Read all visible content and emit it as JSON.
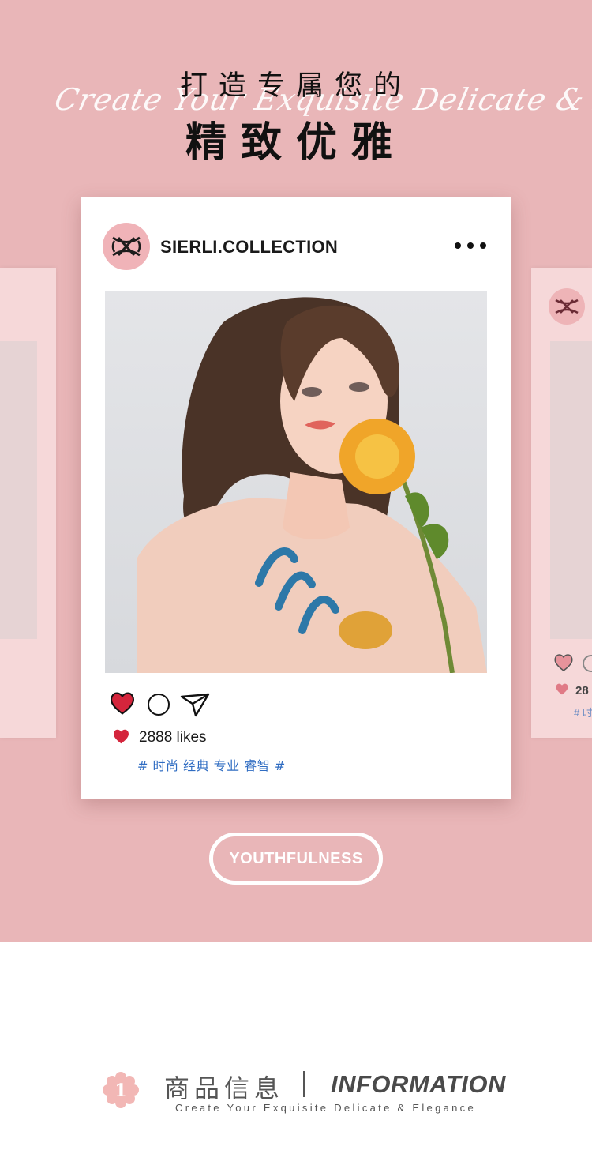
{
  "hero": {
    "title_line1": "打造专属您的",
    "script_text": "Create Your Exquisite Delicate & Elegance",
    "title_line2": "精致优雅",
    "background_color": "#e9b6b8"
  },
  "post": {
    "username": "SIERLI.COLLECTION",
    "more_icon": "more-icon",
    "likes_text": "2888 likes",
    "tags": "# 时尚 经典 专业 睿智 #",
    "icons": [
      "heart-icon",
      "comment-icon",
      "share-icon"
    ],
    "heart_color": "#d4253c",
    "tag_color": "#2f6cc2"
  },
  "side_card_right": {
    "likes_partial": "28",
    "tags_partial": "# 时"
  },
  "badge": {
    "label": "YOUTHFULNESS"
  },
  "info": {
    "number": "1",
    "title_cn": "商品信息",
    "separator": "|",
    "title_en": "INFORMATION",
    "subtitle": "Create Your Exquisite Delicate & Elegance",
    "accent_color": "#f2b7b5"
  }
}
